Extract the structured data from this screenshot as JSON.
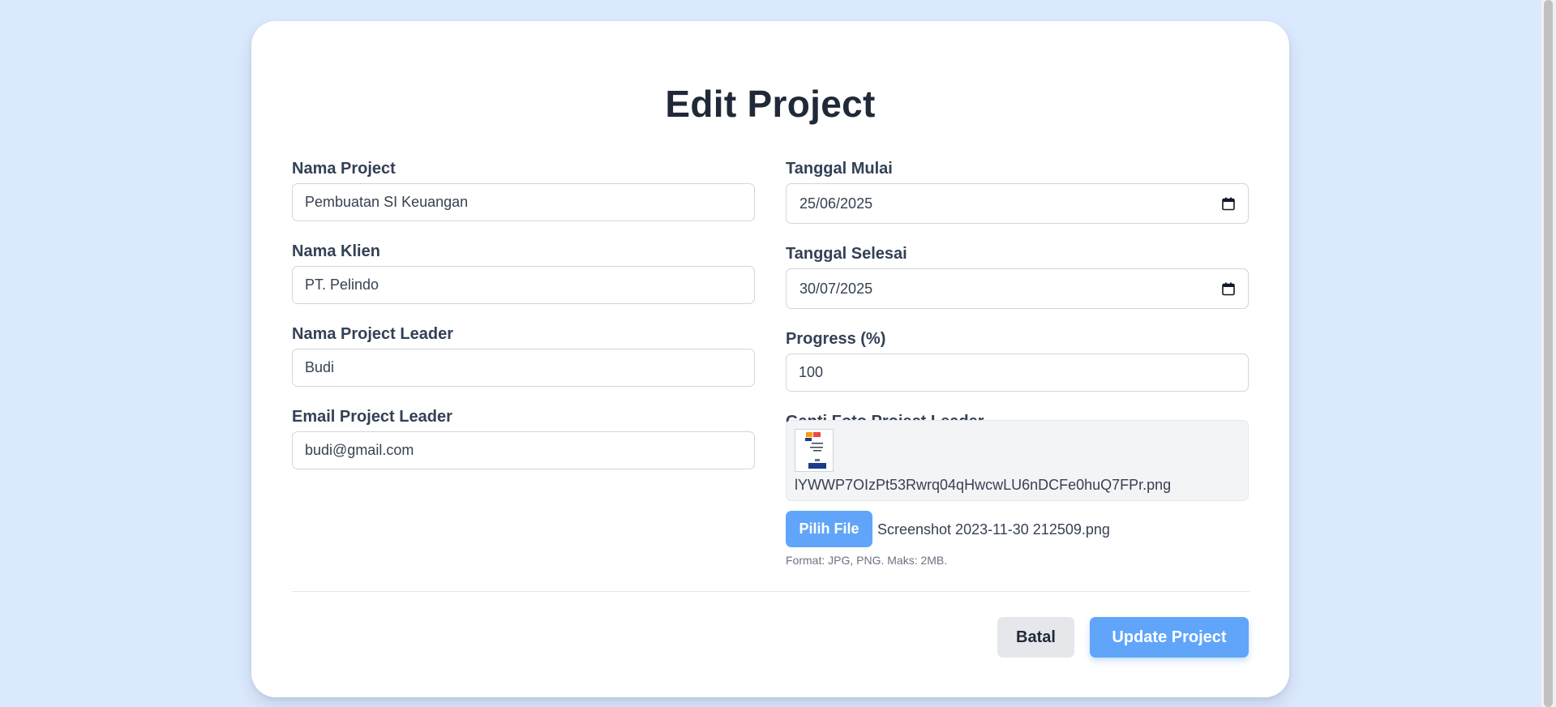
{
  "form": {
    "title": "Edit Project",
    "left_fields": [
      {
        "label": "Nama Project",
        "value": "Pembuatan SI Keuangan"
      },
      {
        "label": "Nama Klien",
        "value": "PT. Pelindo"
      },
      {
        "label": "Nama Project Leader",
        "value": "Budi"
      },
      {
        "label": "Email Project Leader",
        "value": "budi@gmail.com"
      }
    ],
    "start_date": {
      "label": "Tanggal Mulai",
      "value": "25/06/2025"
    },
    "end_date": {
      "label": "Tanggal Selesai",
      "value": "30/07/2025"
    },
    "progress": {
      "label": "Progress (%)",
      "value": "100"
    },
    "photo": {
      "label": "Ganti Foto Project Leader",
      "current_filename": "lYWWP7OIzPt53Rwrq04qHwcwLU6nDCFe0huQ7FPr.png",
      "button_label": "Pilih File",
      "selected_filename": "Screenshot 2023-11-30 212509.png",
      "hint": "Format: JPG, PNG. Maks: 2MB."
    },
    "actions": {
      "cancel_label": "Batal",
      "submit_label": "Update Project"
    }
  },
  "colors": {
    "background": "#dbe9fe",
    "card": "#ffffff",
    "primary_button": "#60a5fa",
    "secondary_button": "#e5e7eb",
    "title_text": "#1f2937"
  },
  "icons": {
    "calendar": "calendar-icon"
  }
}
